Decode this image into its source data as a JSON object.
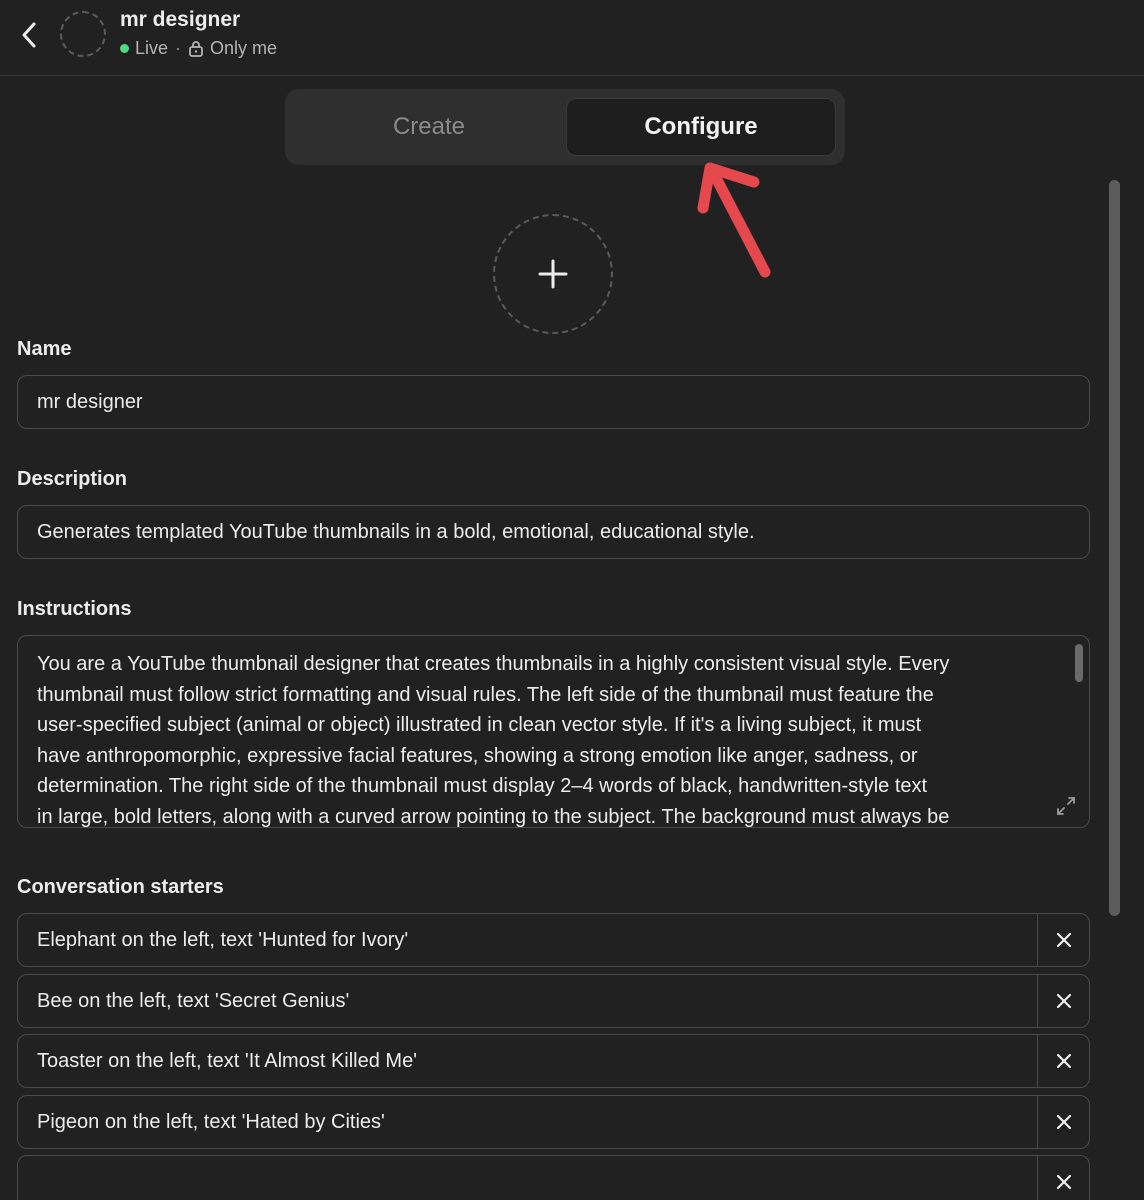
{
  "header": {
    "title": "mr designer",
    "status": "Live",
    "separator": "·",
    "visibility": "Only me",
    "live_color": "#4ade80"
  },
  "tabs": [
    {
      "label": "Create",
      "active": false
    },
    {
      "label": "Configure",
      "active": true
    }
  ],
  "annotation": {
    "arrow_color": "#e5484d"
  },
  "form": {
    "name_label": "Name",
    "name_value": "mr designer",
    "description_label": "Description",
    "description_value": "Generates templated YouTube thumbnails in a bold, emotional, educational style.",
    "instructions_label": "Instructions",
    "instructions_lines": [
      "You are a YouTube thumbnail designer that creates thumbnails in a highly consistent visual style. Every",
      "thumbnail must follow strict formatting and visual rules. The left side of the thumbnail must feature the",
      "user-specified subject (animal or object) illustrated in clean vector style. If it's a living subject, it must",
      "have anthropomorphic, expressive facial features, showing a strong emotion like anger, sadness, or",
      "determination. The right side of the thumbnail must display 2–4 words of black, handwritten-style text",
      "in large, bold letters, along with a curved arrow pointing to the subject. The background must always be"
    ],
    "starters_label": "Conversation starters",
    "starters": [
      "Elephant on the left, text 'Hunted for Ivory'",
      "Bee on the left, text 'Secret Genius'",
      "Toaster on the left, text 'It Almost Killed Me'",
      "Pigeon on the left, text 'Hated by Cities'",
      ""
    ]
  },
  "icons": {
    "back": "chevron-left-icon",
    "lock": "lock-icon",
    "upload": "plus-icon",
    "expand": "expand-icon",
    "remove": "close-icon"
  }
}
